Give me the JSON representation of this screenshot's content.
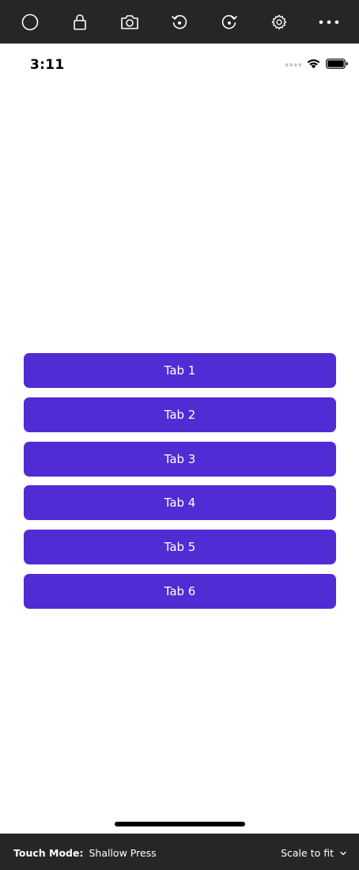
{
  "toolbar": {
    "icons": [
      "circle-icon",
      "lock-icon",
      "camera-icon",
      "rotate-left-icon",
      "rotate-right-icon",
      "gear-icon",
      "more-icon"
    ]
  },
  "status_bar": {
    "time": "3:11"
  },
  "tabs": [
    {
      "label": "Tab 1"
    },
    {
      "label": "Tab 2"
    },
    {
      "label": "Tab 3"
    },
    {
      "label": "Tab 4"
    },
    {
      "label": "Tab 5"
    },
    {
      "label": "Tab 6"
    }
  ],
  "bottom_bar": {
    "touch_mode_label": "Touch Mode:",
    "touch_mode_value": "Shallow Press",
    "scale_value": "Scale to fit"
  },
  "colors": {
    "tab_background": "#512bd4",
    "toolbar_background": "#262626"
  }
}
